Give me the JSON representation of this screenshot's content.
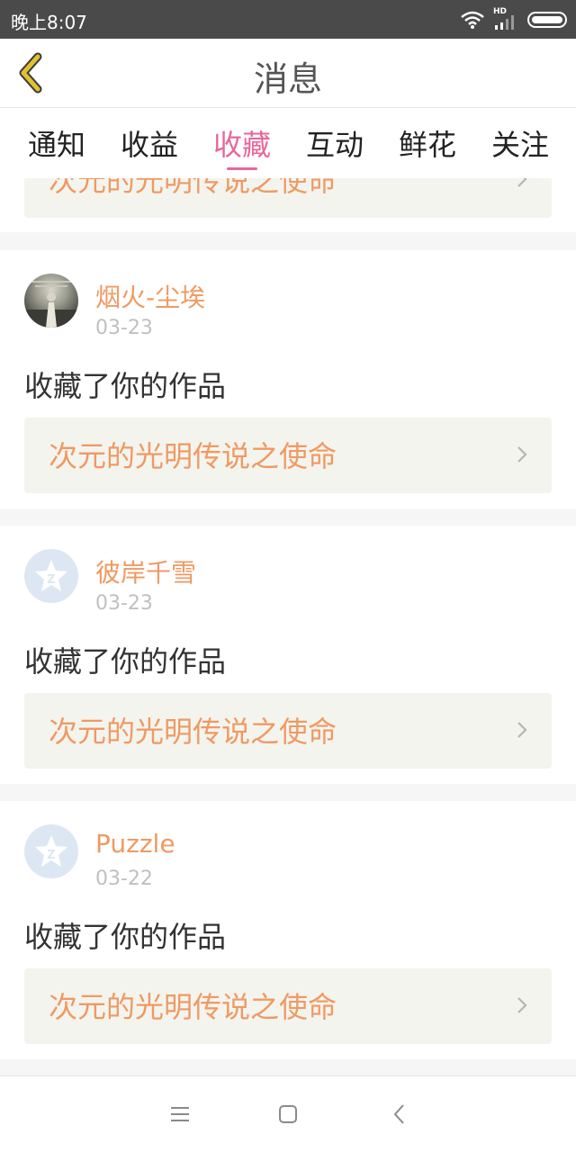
{
  "status_bar": {
    "time": "晚上8:07",
    "network": "HD"
  },
  "header": {
    "title": "消息"
  },
  "tabs": [
    {
      "label": "通知",
      "active": false
    },
    {
      "label": "收益",
      "active": false
    },
    {
      "label": "收藏",
      "active": true
    },
    {
      "label": "互动",
      "active": false
    },
    {
      "label": "鲜花",
      "active": false
    },
    {
      "label": "关注",
      "active": false
    }
  ],
  "partial_card": {
    "work_title": "次元的光明传说之使命"
  },
  "notifications": [
    {
      "user": "烟火-尘埃",
      "date": "03-23",
      "action": "收藏了你的作品",
      "work_title": "次元的光明传说之使命",
      "avatar": "photo-avatar"
    },
    {
      "user": "彼岸千雪",
      "date": "03-23",
      "action": "收藏了你的作品",
      "work_title": "次元的光明传说之使命",
      "avatar": "default-avatar"
    },
    {
      "user": "Puzzle",
      "date": "03-22",
      "action": "收藏了你的作品",
      "work_title": "次元的光明传说之使命",
      "avatar": "default-avatar"
    }
  ],
  "colors": {
    "accent": "#e8679b",
    "link": "#ef9a63",
    "back_icon": "#e2c12f"
  }
}
